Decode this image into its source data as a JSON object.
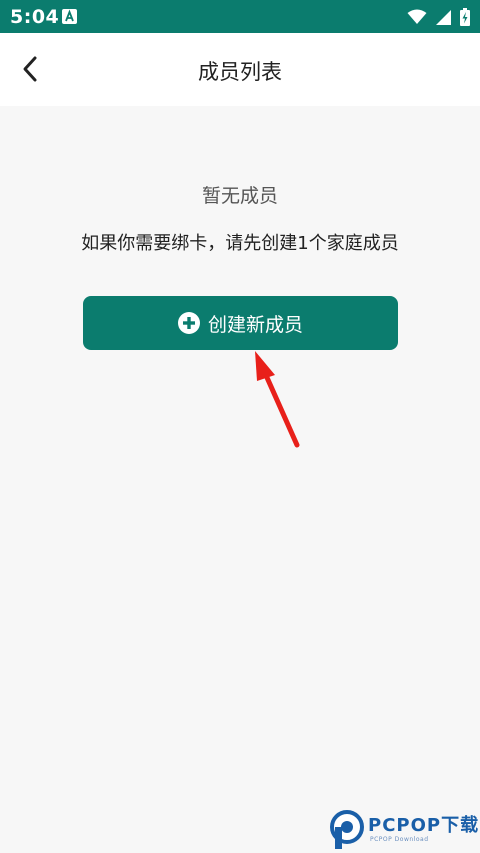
{
  "status_bar": {
    "time": "5:04",
    "background": "#0b7c6e"
  },
  "app_bar": {
    "title": "成员列表",
    "back_icon": "chevron-left-icon"
  },
  "empty_state": {
    "title": "暂无成员",
    "description": "如果你需要绑卡，请先创建1个家庭成员"
  },
  "create_button": {
    "label": "创建新成员",
    "icon": "plus-circle-icon",
    "color": "#0b7c6e"
  },
  "annotation": {
    "arrow_color": "#e8201a"
  },
  "watermark": {
    "main": "PCPOP下载",
    "sub": "PCPOP Download"
  }
}
